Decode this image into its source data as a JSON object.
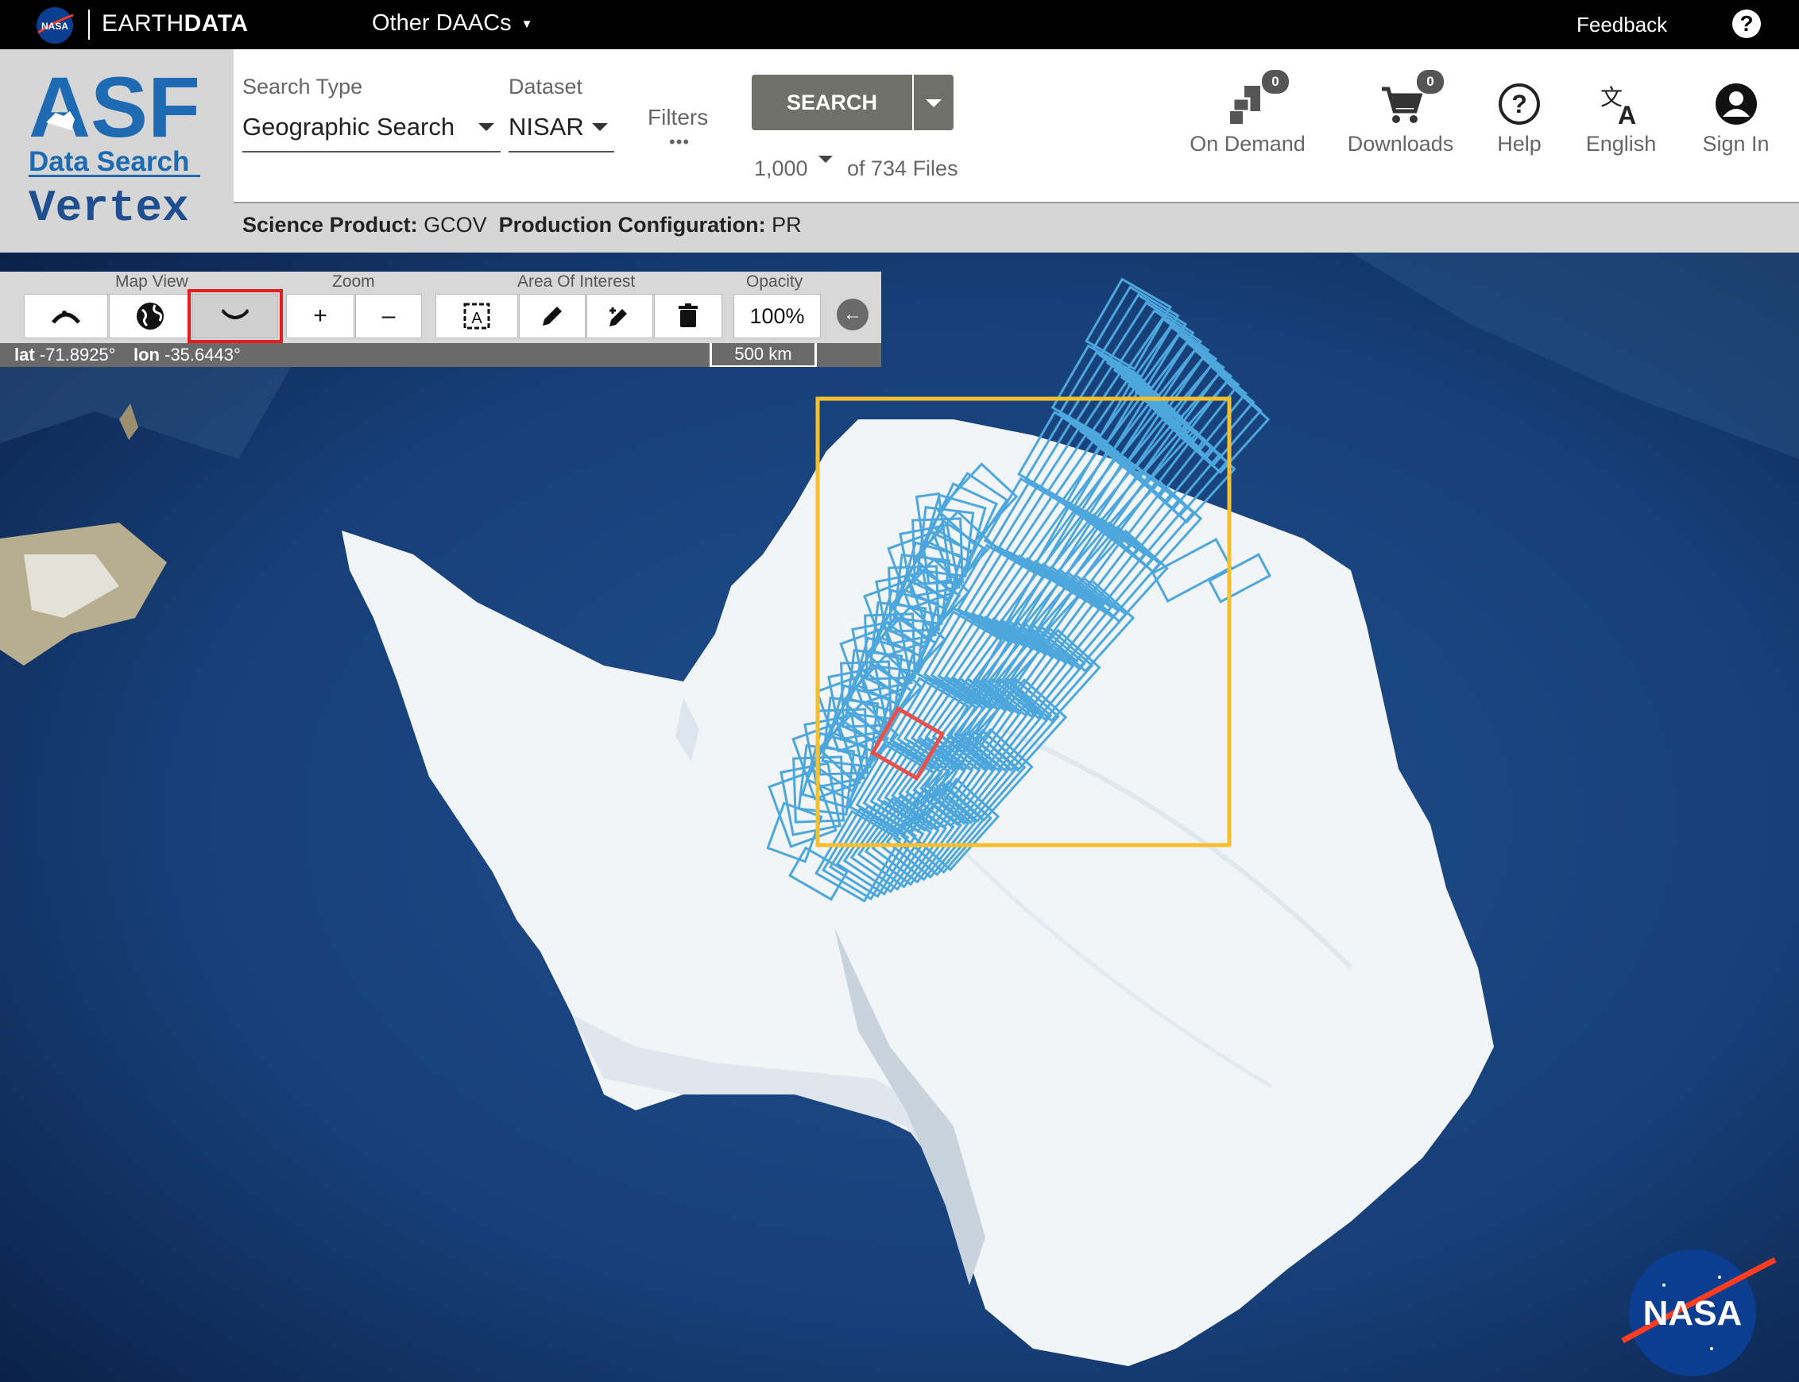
{
  "topbar": {
    "brand_prefix": "EARTH",
    "brand_suffix": "DATA",
    "other_daacs": "Other DAACs",
    "feedback": "Feedback",
    "help": "?"
  },
  "logo": {
    "line1": "ASF",
    "line2": "Data Search",
    "line3": "Vertex"
  },
  "search": {
    "type_label": "Search Type",
    "type_value": "Geographic Search",
    "dataset_label": "Dataset",
    "dataset_value": "NISAR",
    "filters_label": "Filters",
    "filters_dots": "•••",
    "search_button": "SEARCH",
    "max_results": "1,000",
    "file_count": "of 734 Files"
  },
  "header_buttons": {
    "on_demand": {
      "label": "On Demand",
      "badge": "0"
    },
    "downloads": {
      "label": "Downloads",
      "badge": "0"
    },
    "help": {
      "label": "Help"
    },
    "language": {
      "label": "English"
    },
    "sign_in": {
      "label": "Sign In"
    }
  },
  "product": {
    "science_label": "Science Product:",
    "science_value": "GCOV",
    "config_label": "Production Configuration:",
    "config_value": "PR"
  },
  "map_toolbar": {
    "map_view_label": "Map View",
    "zoom_label": "Zoom",
    "aoi_label": "Area Of Interest",
    "opacity_label": "Opacity",
    "zoom_in": "+",
    "zoom_out": "–",
    "opacity_value": "100%",
    "lat_label": "lat",
    "lat_value": "-71.8925°",
    "lon_label": "lon",
    "lon_value": "-35.6443°",
    "scale": "500 km",
    "active_view": "antarctic"
  },
  "map": {
    "aoi_color": "#f5c02b",
    "footprint_color": "#4da7dd",
    "selected_color": "#e8504b"
  },
  "nasa_logo_text": "NASA"
}
